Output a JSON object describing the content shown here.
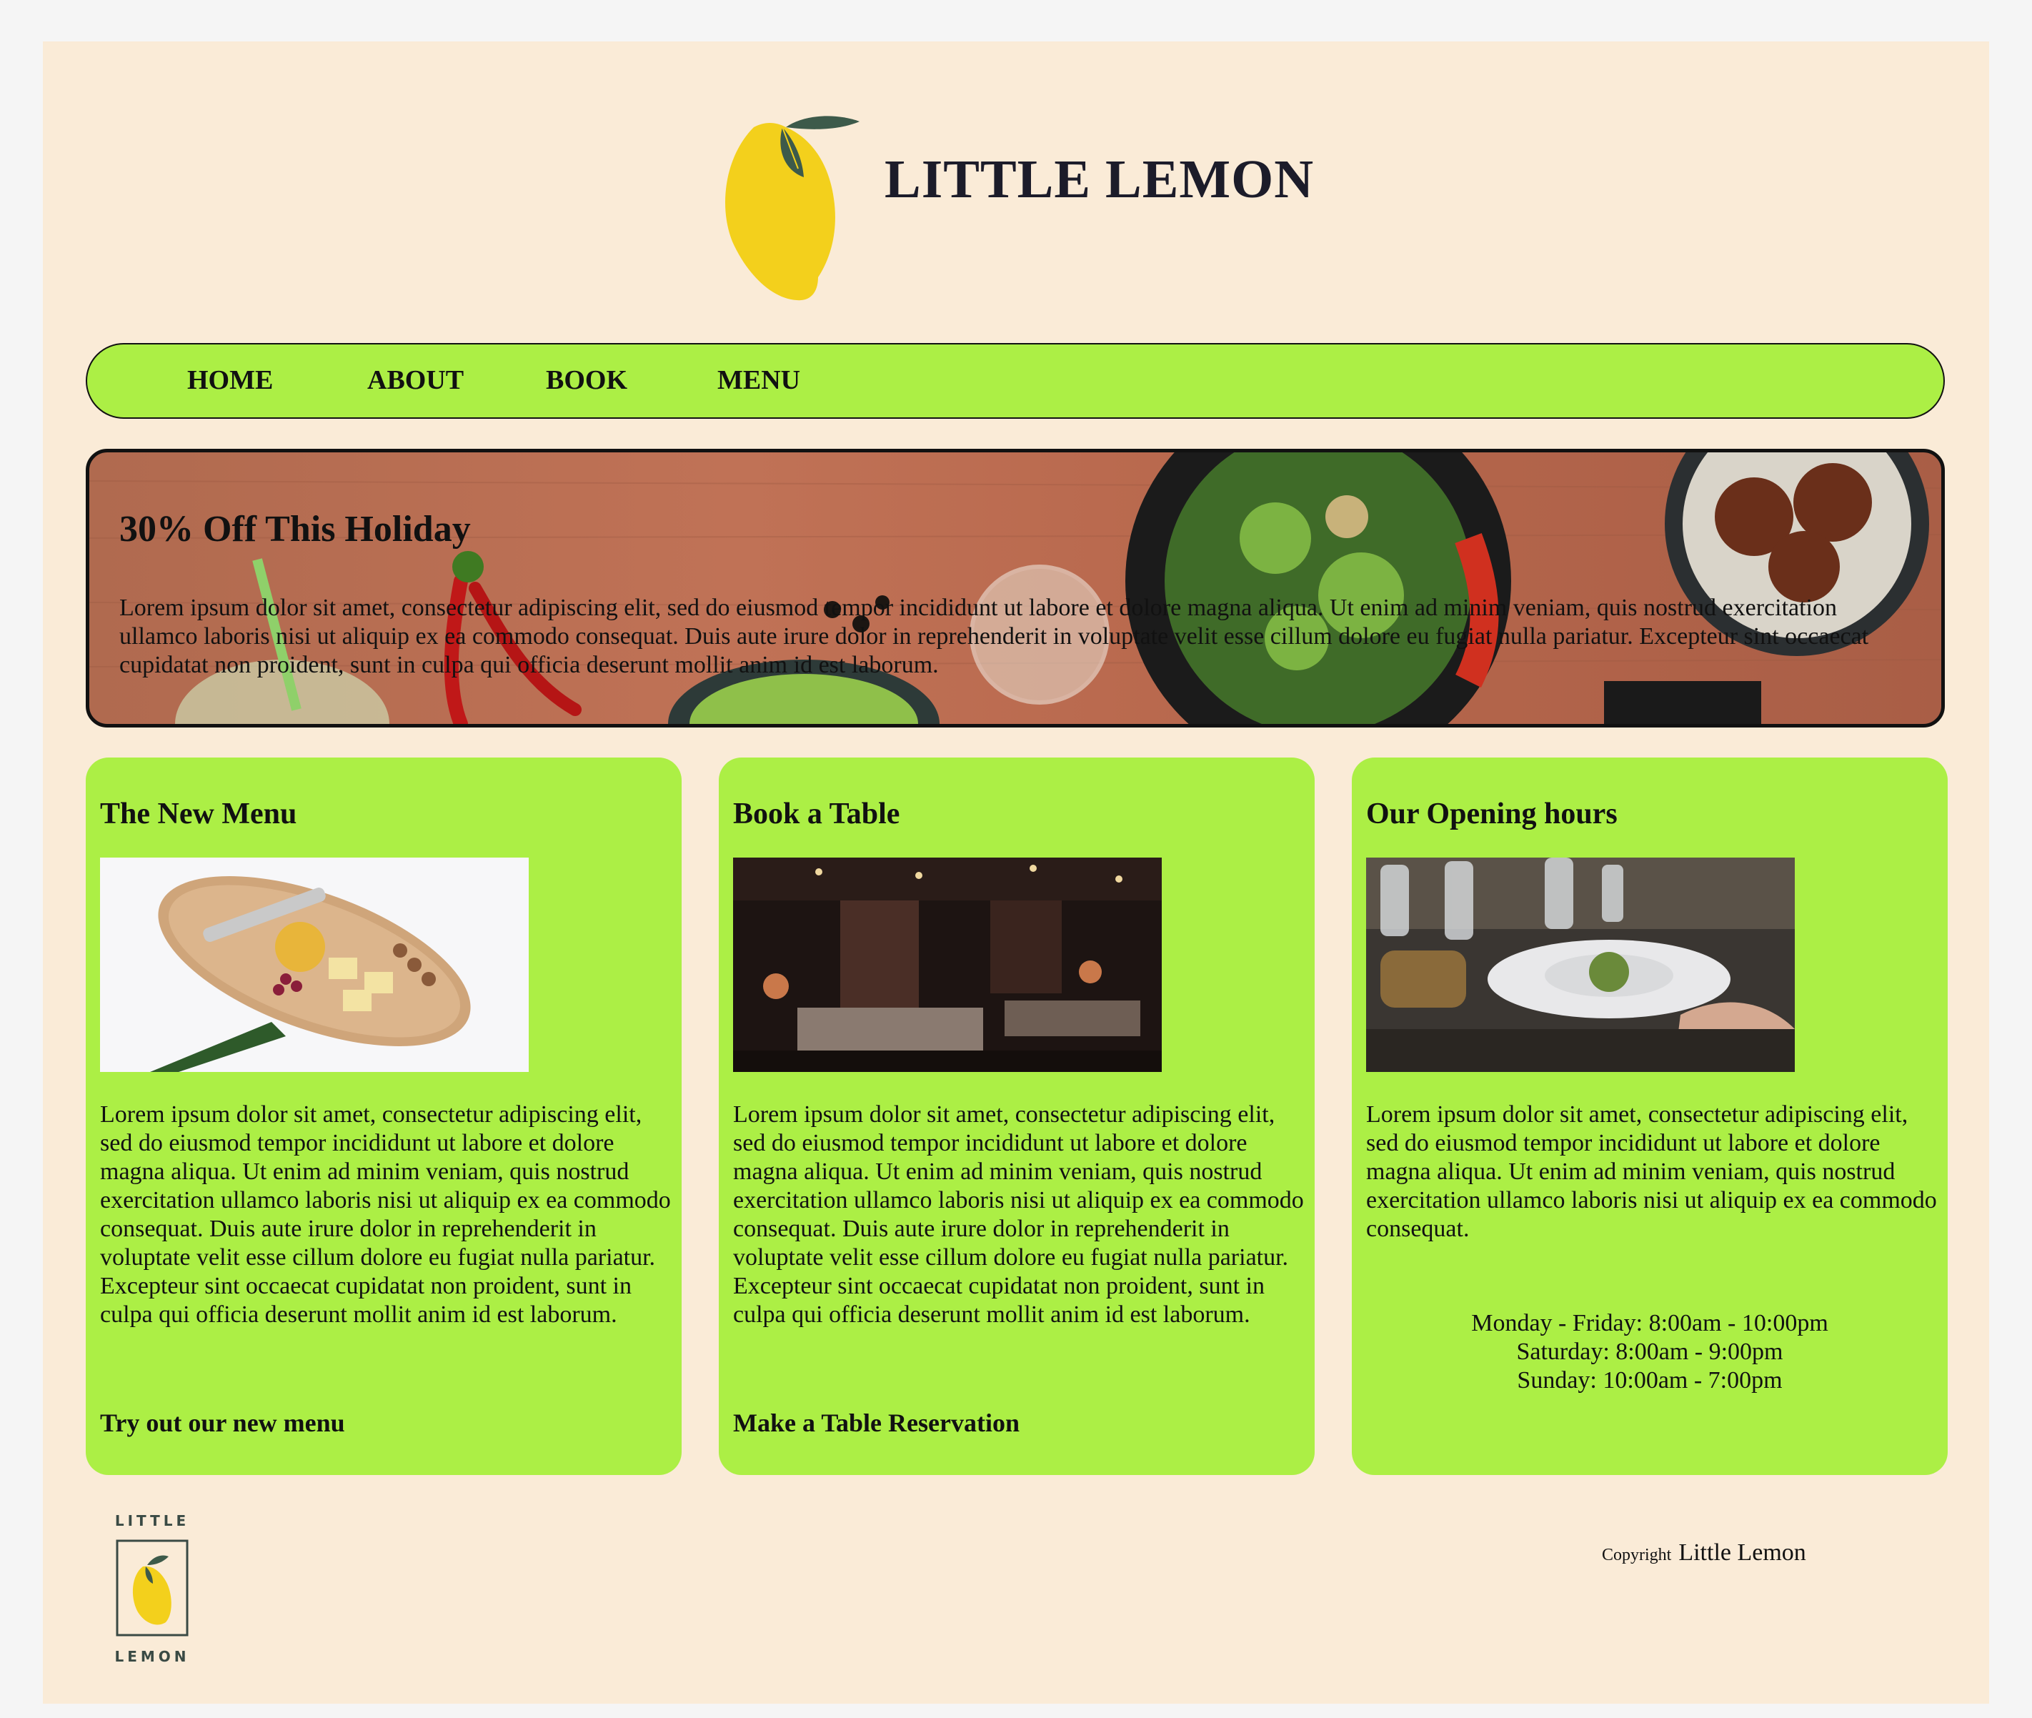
{
  "header": {
    "brand": "LITTLE LEMON",
    "logo_icon": "lemon-logo-icon"
  },
  "nav": {
    "items": [
      "HOME",
      "ABOUT",
      "BOOK",
      "MENU"
    ]
  },
  "banner": {
    "title": "30% Off This Holiday",
    "text": "Lorem ipsum dolor sit amet, consectetur adipiscing elit, sed do eiusmod tempor incididunt ut labore et dolore magna aliqua. Ut enim ad minim veniam, quis nostrud exercitation ullamco laboris nisi ut aliquip ex ea commodo consequat. Duis aute irure dolor in reprehenderit in voluptate velit esse cillum dolore eu fugiat nulla pariatur. Excepteur sint occaecat cupidatat non proident, sunt in culpa qui officia deserunt mollit anim id est laborum."
  },
  "cards": [
    {
      "title": "The New Menu",
      "image": "cheese-board-photo",
      "text": "Lorem ipsum dolor sit amet, consectetur adipiscing elit, sed do eiusmod tempor incididunt ut labore et dolore magna aliqua. Ut enim ad minim veniam, quis nostrud exercitation ullamco laboris nisi ut aliquip ex ea commodo consequat. Duis aute irure dolor in reprehenderit in voluptate velit esse cillum dolore eu fugiat nulla pariatur. Excepteur sint occaecat cupidatat non proident, sunt in culpa qui officia deserunt mollit anim id est laborum.",
      "link": "Try out our new menu"
    },
    {
      "title": "Book a Table",
      "image": "restaurant-interior-photo",
      "text": "Lorem ipsum dolor sit amet, consectetur adipiscing elit, sed do eiusmod tempor incididunt ut labore et dolore magna aliqua. Ut enim ad minim veniam, quis nostrud exercitation ullamco laboris nisi ut aliquip ex ea commodo consequat. Duis aute irure dolor in reprehenderit in voluptate velit esse cillum dolore eu fugiat nulla pariatur. Excepteur sint occaecat cupidatat non proident, sunt in culpa qui officia deserunt mollit anim id est laborum.",
      "link": "Make a Table Reservation"
    },
    {
      "title": "Our Opening hours",
      "image": "dining-table-photo",
      "text": "Lorem ipsum dolor sit amet, consectetur adipiscing elit, sed do eiusmod tempor incididunt ut labore et dolore magna aliqua. Ut enim ad minim veniam, quis nostrud exercitation ullamco laboris nisi ut aliquip ex ea commodo consequat.",
      "hours": [
        "Monday - Friday: 8:00am - 10:00pm",
        "Saturday: 8:00am - 9:00pm",
        "Sunday: 10:00am - 7:00pm"
      ]
    }
  ],
  "footer": {
    "logo_top": "LITTLE",
    "logo_bottom": "LEMON",
    "copyright_label": "Copyright",
    "copyright_name": "Little Lemon"
  },
  "colors": {
    "page_bg": "#faebd7",
    "accent_green": "#acef45",
    "lemon_yellow": "#f3d01c",
    "leaf_green": "#3d5a4a"
  }
}
